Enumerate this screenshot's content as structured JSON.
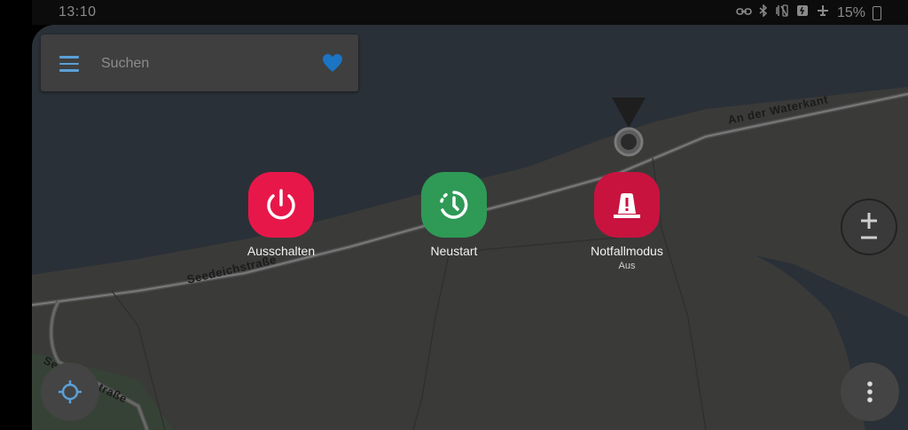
{
  "status_bar": {
    "time": "13:10",
    "battery": "15%",
    "icons": [
      "link-icon",
      "bluetooth-icon",
      "mute-vibrate-icon",
      "battery-saver-icon",
      "airplane-icon",
      "battery-icon"
    ]
  },
  "search": {
    "placeholder": "Suchen"
  },
  "map": {
    "street_labels": [
      "An der Waterkant",
      "Seedeichstraße",
      "Seedeichstraße"
    ]
  },
  "power_menu": {
    "power_off": {
      "label": "Ausschalten",
      "color": "#e8174a"
    },
    "restart": {
      "label": "Neustart",
      "color": "#2e9a56"
    },
    "emergency": {
      "label": "Notfallmodus",
      "sublabel": "Aus",
      "color": "#c8133f"
    }
  },
  "colors": {
    "accent": "#5aa0d8",
    "water": "#2a3037",
    "land": "#3a3a39"
  }
}
